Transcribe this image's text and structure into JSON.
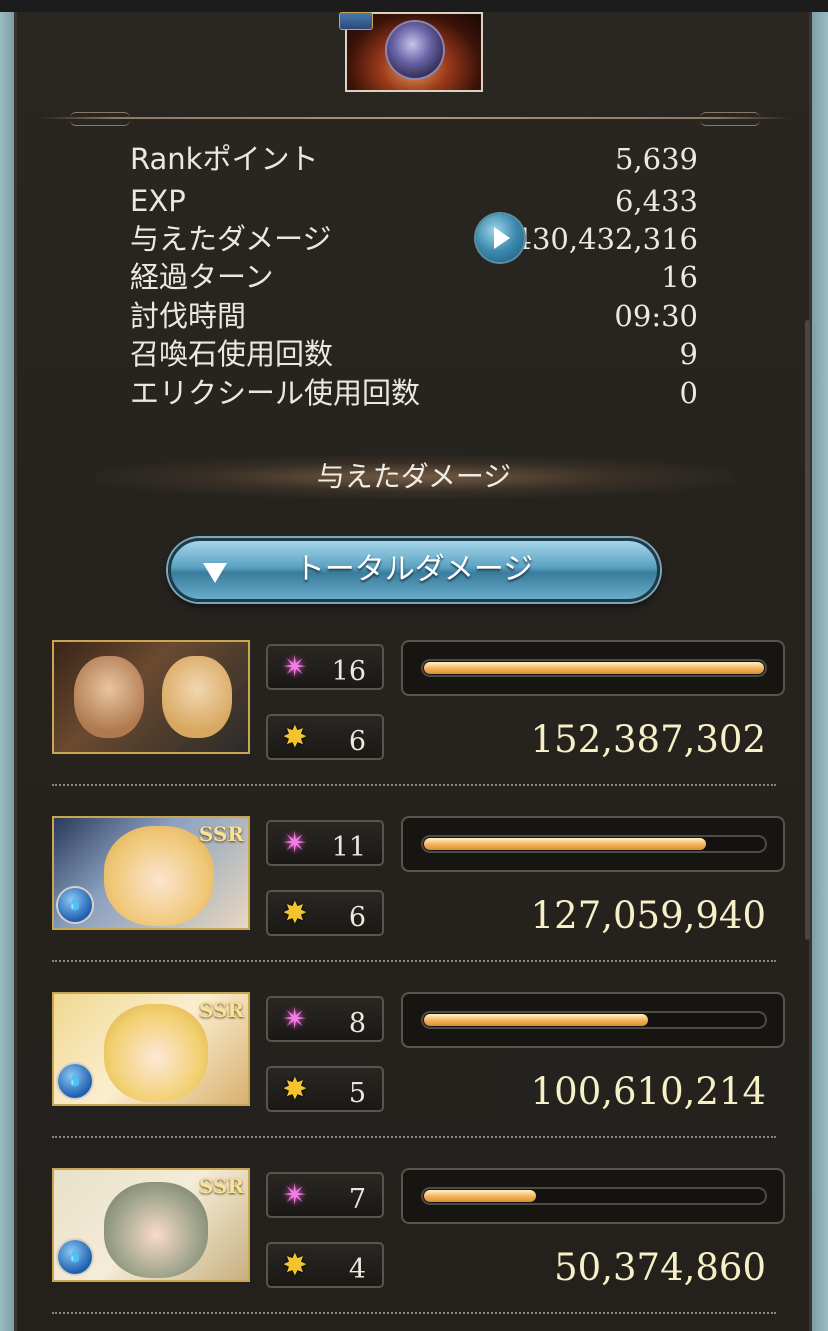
{
  "stats": [
    {
      "label": "Rankポイント",
      "value": "5,639"
    },
    {
      "label": "EXP",
      "value": "6,433"
    },
    {
      "label": "与えたダメージ",
      "value": "430,432,316"
    },
    {
      "label": "経過ターン",
      "value": "16"
    },
    {
      "label": "討伐時間",
      "value": "09:30"
    },
    {
      "label": "召喚石使用回数",
      "value": "9"
    },
    {
      "label": "エリクシール使用回数",
      "value": "0"
    }
  ],
  "section_title": "与えたダメージ",
  "dropdown": {
    "label": "トータルダメージ"
  },
  "ranking": [
    {
      "ability_uses": "16",
      "ca_uses": "6",
      "damage": "152,387,302",
      "bar_fraction": 1.0,
      "rarity": "",
      "element_icon": ""
    },
    {
      "ability_uses": "11",
      "ca_uses": "6",
      "damage": "127,059,940",
      "bar_fraction": 0.83,
      "rarity": "SSR",
      "element_icon": "water-element-icon"
    },
    {
      "ability_uses": "8",
      "ca_uses": "5",
      "damage": "100,610,214",
      "bar_fraction": 0.66,
      "rarity": "SSR",
      "element_icon": "water-element-icon"
    },
    {
      "ability_uses": "7",
      "ca_uses": "4",
      "damage": "50,374,860",
      "bar_fraction": 0.33,
      "rarity": "SSR",
      "element_icon": "water-element-icon"
    }
  ],
  "icons": {
    "ability": "ability-sparkle-icon",
    "charge_attack": "charge-attack-icon",
    "play": "play-icon"
  },
  "colors": {
    "bar_fill": "#f2b35a",
    "damage_text": "#f6f0c8",
    "accent_blue": "#5aa2c2"
  }
}
